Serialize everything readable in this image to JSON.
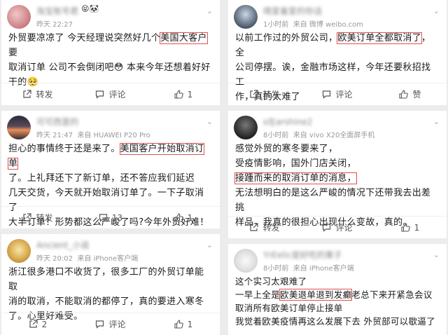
{
  "cards": [
    {
      "name": "淘宝账号君",
      "time": "昨天 22:27",
      "source": "",
      "lines": [
        [
          "外贸要凉凉了 今天经理说突然好几个",
          "美国大客户",
          "要"
        ],
        [
          "取消订单 公司不会倒闭吧😳 本来今年还想着好好"
        ],
        [
          "干的🥺"
        ]
      ],
      "repost": "转发",
      "comment": "评论",
      "like": "1"
    },
    {
      "name": "晴爱着爱的你话",
      "time": "1小时前",
      "source": "来自 微博 weibo.com",
      "lines": [
        [
          "以前工作过的外贸公司，",
          "欧美订单全都取消了",
          "，全"
        ],
        [
          "公司停摆。诶，金融市场这样，今年还要秋招找工"
        ],
        [
          "作，真的太难了"
        ]
      ],
      "repost": "转发",
      "comment": "评论",
      "like": "赞"
    },
    {
      "name": "可可西里的",
      "time": "昨天 21:47",
      "source": "来自 HUAWEI P20 Pro",
      "lines": [
        [
          "担心的事情终于还是来了。",
          "美国客户开始取消订单"
        ],
        [
          "了。上礼拜还下了新订单，还不答应我们延迟"
        ],
        [
          "几天交货，今天就开始取消订单了。一下子取消了"
        ],
        [
          "大半订单！形势都这么严峻了吗?今年外贸好难！"
        ]
      ],
      "repost": "转发",
      "comment": "13",
      "like": "1"
    },
    {
      "name": "s在arshine2",
      "time": "8小时前",
      "source": "来自 vivo X20全面屏手机",
      "lines": [
        [
          "感觉外贸的寒冬要来了，"
        ],
        [
          "受疫情影响，国外门店关闭，"
        ],
        [
          "接踵而来的取消订单的消息，"
        ],
        [
          "无法想明白的是这么严峻的情况下还带我去出差挑"
        ],
        [
          "样品，我真的很担心出现什么变故，真的。"
        ]
      ],
      "repost": "转发",
      "comment": "评论",
      "like": "1"
    },
    {
      "name": "Ancient_小说",
      "time": "昨天 20:02",
      "source": "来自 iPhone客户端",
      "lines": [
        [
          "浙江很多港口不收货了，很多工厂的外贸订单能取"
        ],
        [
          "消的取消，不能取消的都停了，真的要进入寒冬"
        ],
        [
          "了。心里好难受。"
        ]
      ],
      "repost": "2",
      "comment": "评论",
      "like": "1"
    },
    {
      "name": "YrEelic是好吃的栗子",
      "time": "8小时前",
      "source": "来自 iPhone客户端",
      "lines": [
        [
          "这个实习太艰难了"
        ],
        [
          "一早上全是",
          "欧美退单退到发癫",
          "老总下来开紧急会议"
        ],
        [
          "取消所有欧美订单停止接单"
        ],
        [
          "我觉着欧美疫情再这么发展下去 外贸部可以歇逼了"
        ]
      ],
      "repost": "",
      "comment": "",
      "like": ""
    }
  ]
}
